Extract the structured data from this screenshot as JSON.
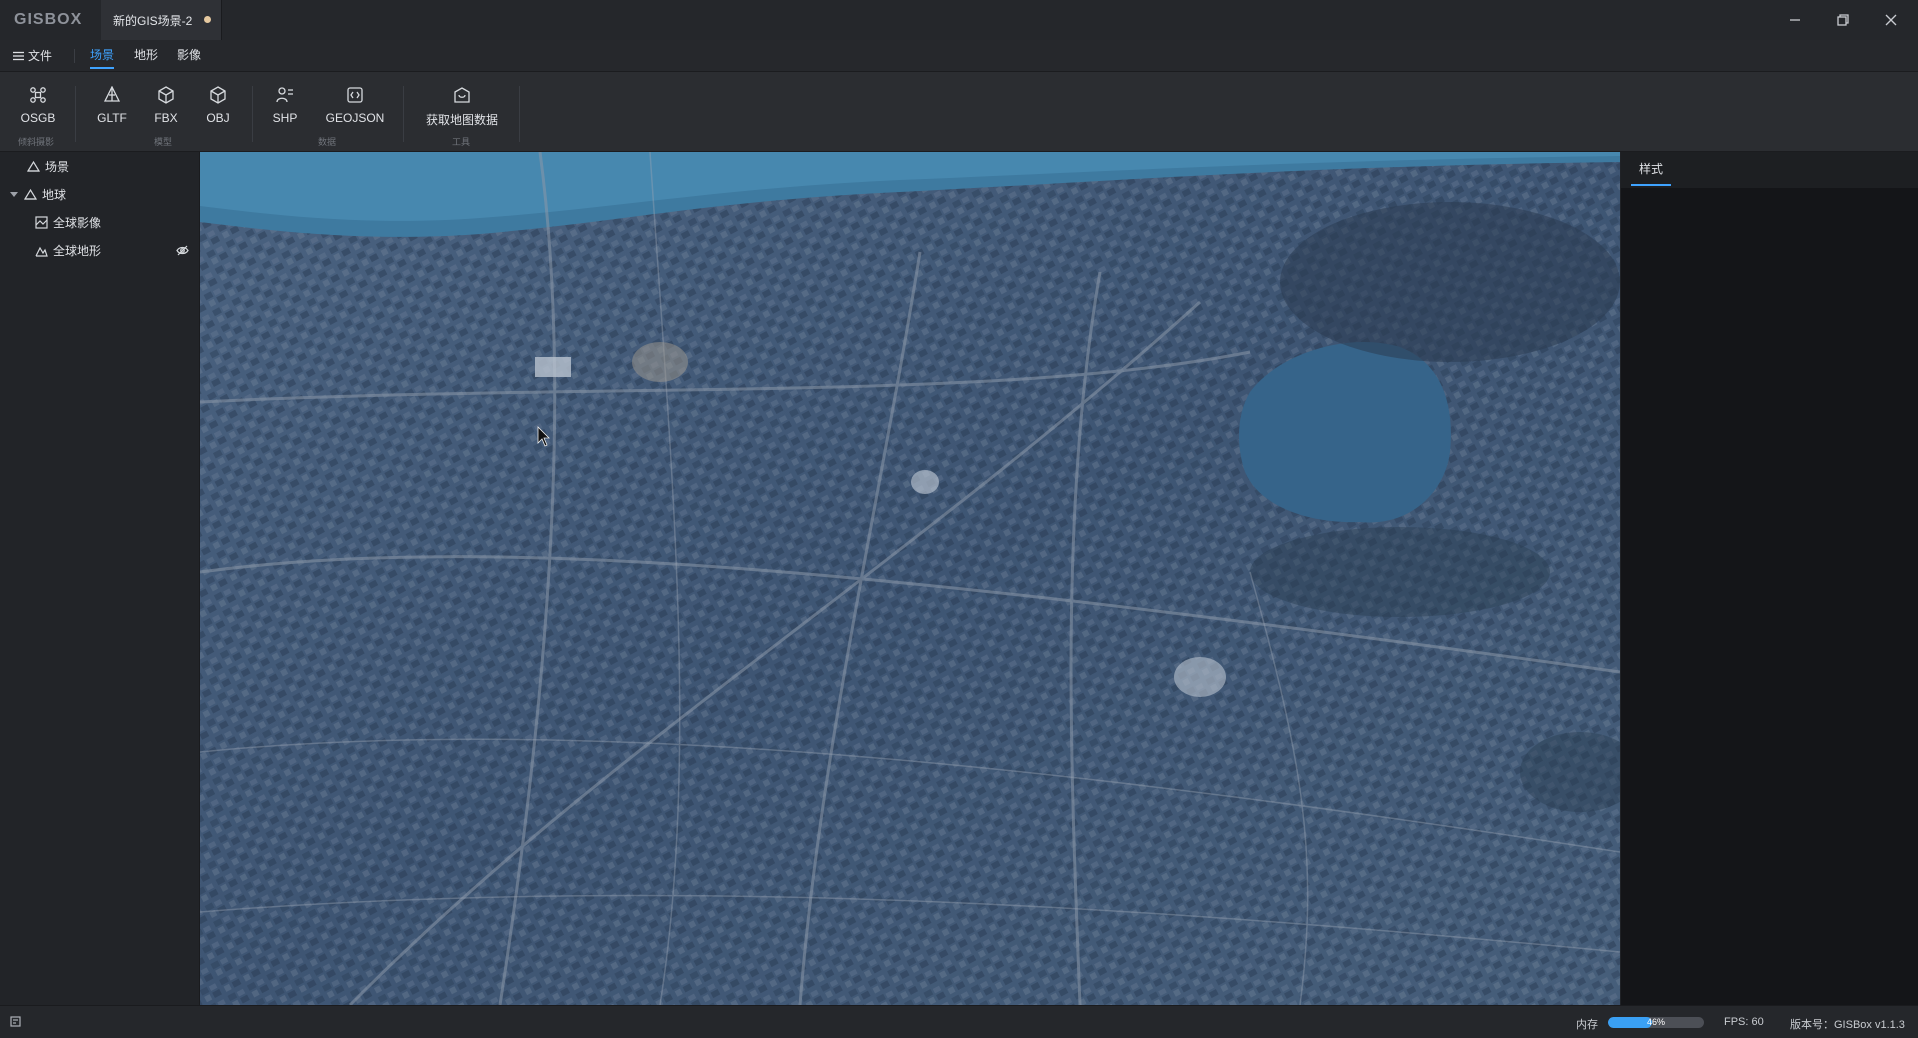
{
  "app": {
    "logo": "GISBOX",
    "tab_title": "新的GIS场景-2"
  },
  "menu": {
    "file": "文件",
    "tabs": [
      {
        "label": "场景",
        "active": true
      },
      {
        "label": "地形",
        "active": false
      },
      {
        "label": "影像",
        "active": false
      }
    ]
  },
  "ribbon": {
    "buttons": [
      {
        "label": "OSGB",
        "icon": "osgb-icon"
      },
      {
        "label": "GLTF",
        "icon": "gltf-icon"
      },
      {
        "label": "FBX",
        "icon": "fbx-icon"
      },
      {
        "label": "OBJ",
        "icon": "obj-icon"
      },
      {
        "label": "SHP",
        "icon": "shp-icon"
      },
      {
        "label": "GEOJSON",
        "icon": "geojson-icon"
      },
      {
        "label": "获取地图数据",
        "icon": "get-map-data-icon"
      }
    ],
    "groups": [
      "倾斜摄影",
      "模型",
      "数据",
      "工具"
    ]
  },
  "tree": {
    "scene": "场景",
    "earth": "地球",
    "imagery": "全球影像",
    "terrain": "全球地形"
  },
  "right_panel": {
    "tab": "样式"
  },
  "status": {
    "memory_label": "内存",
    "memory_percent": 46,
    "memory_text": "46%",
    "fps": "FPS: 60",
    "version": "版本号：GISBox v1.1.3"
  },
  "colors": {
    "accent": "#3fa3ff",
    "background": "#202226",
    "panel": "#222428",
    "memory_fill": "#3aa0f5"
  }
}
